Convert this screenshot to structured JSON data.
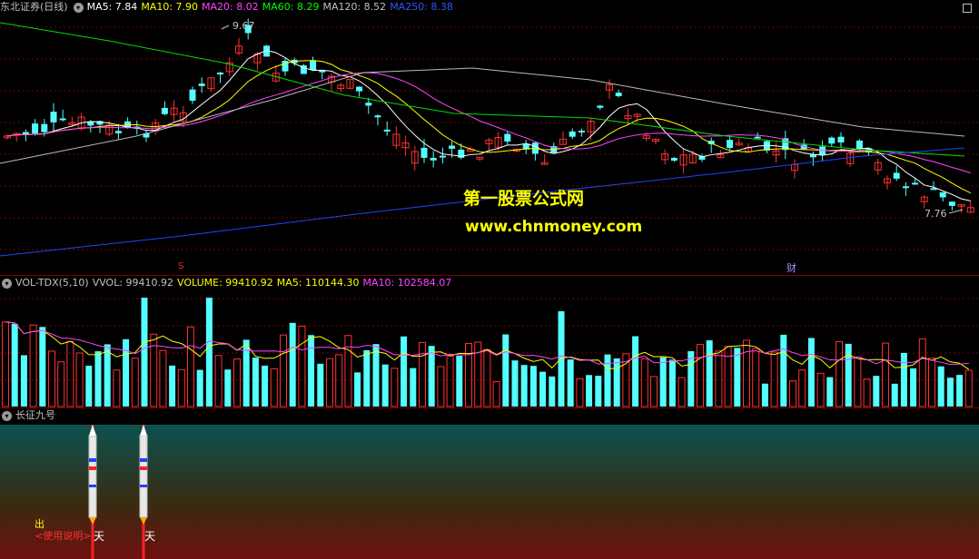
{
  "main": {
    "stock": "东北证券",
    "period": "(日线)",
    "ma": [
      {
        "label": "MA5:",
        "value": "7.84",
        "color": "#ffffff"
      },
      {
        "label": "MA10:",
        "value": "7.90",
        "color": "#ffff00"
      },
      {
        "label": "MA20:",
        "value": "8.02",
        "color": "#ff44ff"
      },
      {
        "label": "MA60:",
        "value": "8.29",
        "color": "#00ff00"
      },
      {
        "label": "MA120:",
        "value": "8.52",
        "color": "#c0c0c0"
      },
      {
        "label": "MA250:",
        "value": "8.38",
        "color": "#3355ff"
      }
    ],
    "high_label": "9.67",
    "low_label": "7.76",
    "marker_s": "S",
    "marker_cai": "财",
    "watermark1": "第一股票公式网",
    "watermark2": "www.chnmoney.com"
  },
  "vol": {
    "name": "VOL-TDX(5,10)",
    "vvol": "VVOL: 99410.92",
    "volume": "VOLUME: 99410.92",
    "ma5": "MA5: 110144.30",
    "ma10": "MA10: 102584.07"
  },
  "ind": {
    "name": "长征九号",
    "chu": "出",
    "usage": "<使用说明>",
    "tian1": "天",
    "tian2": "天"
  }
}
